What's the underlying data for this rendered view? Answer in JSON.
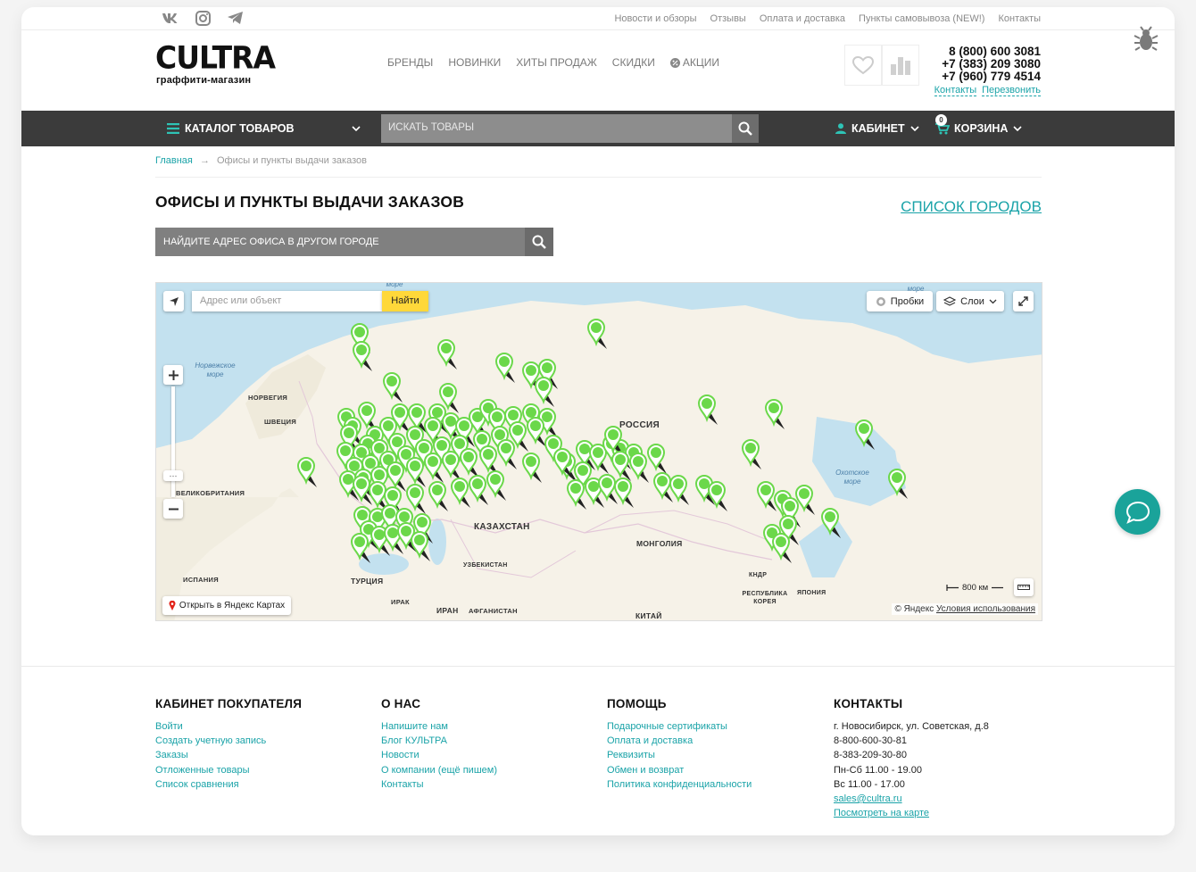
{
  "social": {
    "vk": "vk-icon",
    "instagram": "instagram-icon",
    "telegram": "telegram-icon"
  },
  "toplinks": [
    "Новости и обзоры",
    "Отзывы",
    "Оплата и доставка",
    "Пункты самовывоза (NEW!)",
    "Контакты"
  ],
  "logo": {
    "main": "CULTRA",
    "sub": "граффити-магазин"
  },
  "mainnav": {
    "brands": "БРЕНДЫ",
    "new": "НОВИНКИ",
    "hits": "ХИТЫ ПРОДАЖ",
    "sales": "СКИДКИ",
    "promo": "АКЦИИ"
  },
  "phones": {
    "p1": "8 (800) 600 3081",
    "p2": "+7 (383) 209 3080",
    "p3": "+7 (960) 779 4514",
    "contacts": "Контакты",
    "callback": "Перезвонить"
  },
  "darknav": {
    "catalog": "КАТАЛОГ ТОВАРОВ",
    "search_placeholder": "ИСКАТЬ ТОВАРЫ",
    "cabinet": "КАБИНЕТ",
    "cart": "КОРЗИНА",
    "cart_count": "0"
  },
  "breadcrumb": {
    "home": "Главная",
    "sep": "→",
    "current": "Офисы и пункты выдачи заказов"
  },
  "page": {
    "title": "ОФИСЫ И ПУНКТЫ ВЫДАЧИ ЗАКАЗОВ",
    "city_list": "СПИСОК ГОРОДОВ",
    "city_search": "НАЙДИТЕ АДРЕС ОФИСА В ДРУГОМ ГОРОДЕ"
  },
  "map": {
    "search_placeholder": "Адрес или объект",
    "find": "Найти",
    "traffic": "Пробки",
    "layers": "Слои",
    "open_yandex": "Открыть в Яндекс Картах",
    "scale": "800 км",
    "copyright": "© Яндекс",
    "terms": "Условия использования",
    "labels": {
      "russia": "РОССИЯ",
      "kazakhstan": "КАЗАХСТАН",
      "mongolia": "МОНГОЛИЯ",
      "norway": "НОРВЕГИЯ",
      "sweden": "ШВЕЦИЯ",
      "uk": "ВЕЛИКОБРИТАНИЯ",
      "spain": "ИСПАНИЯ",
      "turkey": "ТУРЦИЯ",
      "iraq": "ИРАК",
      "iran": "ИРАН",
      "afghanistan": "АФГАНИСТАН",
      "uzbekistan": "УЗБЕКИСТАН",
      "china": "КИТАЙ",
      "dprk": "КНДР",
      "korea": "РЕСПУБЛИКА КОРЕЯ",
      "japan": "ЯПОНИЯ",
      "norwegian_sea": "Норвежское море",
      "okhotsk_sea": "Охотское море",
      "sea_top1": "море",
      "sea_top2": "море"
    }
  },
  "footer": {
    "buyer": {
      "title": "КАБИНЕТ ПОКУПАТЕЛЯ",
      "items": [
        "Войти",
        "Создать учетную запись",
        "Заказы",
        "Отложенные товары",
        "Список сравнения"
      ]
    },
    "about": {
      "title": "О НАС",
      "items": [
        "Напишите нам",
        "Блог КУЛЬТРА",
        "Новости",
        "О компании (ещё пишем)",
        "Контакты"
      ]
    },
    "help": {
      "title": "ПОМОЩЬ",
      "items": [
        "Подарочные сертификаты",
        "Оплата и доставка",
        "Реквизиты",
        "Обмен и возврат",
        "Политика конфиденциальности"
      ]
    },
    "contacts": {
      "title": "КОНТАКТЫ",
      "address": "г. Новосибирск, ул. Советская, д.8",
      "phone1": "8-800-600-30-81",
      "phone2": "8-383-209-30-80",
      "hours1": "Пн-Сб 11.00 - 19.00",
      "hours2": "Вс 11.00 - 17.00",
      "email": "sales@cultra.ru",
      "map_link": "Посмотреть на карте"
    }
  },
  "colors": {
    "accent": "#1aa3a8",
    "dark_nav": "#3b3b3b",
    "marker": "#6bd84a",
    "find_button": "#ffd83a"
  }
}
